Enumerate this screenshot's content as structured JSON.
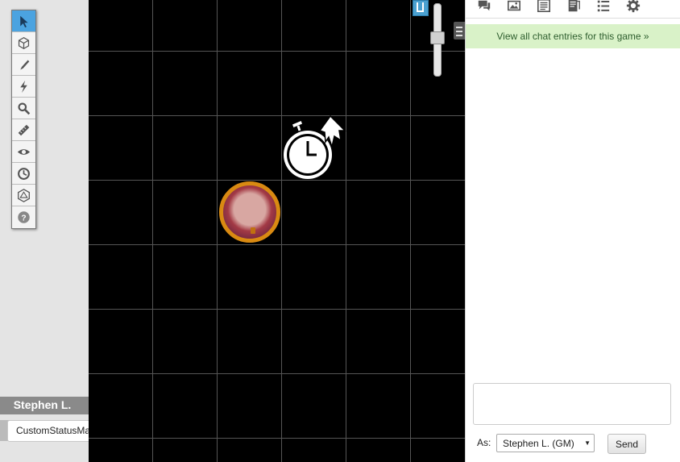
{
  "toolbar": {
    "tools": [
      {
        "name": "select-icon",
        "active": true
      },
      {
        "name": "layers-icon"
      },
      {
        "name": "draw-icon"
      },
      {
        "name": "fx-icon"
      },
      {
        "name": "zoom-icon"
      },
      {
        "name": "ruler-icon"
      },
      {
        "name": "fog-icon"
      },
      {
        "name": "turn-tracker-icon"
      },
      {
        "name": "dice-icon"
      },
      {
        "name": "help-icon"
      }
    ]
  },
  "player": {
    "name": "Stephen L.",
    "color": "#1ef0f0"
  },
  "tooltip": {
    "text": "CustomStatusMarkersMenu"
  },
  "map": {
    "background": "#000000",
    "grid_color": "#555555"
  },
  "right_panel": {
    "tabs": [
      "chat-icon",
      "art-library-icon",
      "journal-icon",
      "compendium-icon",
      "jukebox-list-icon",
      "settings-icon"
    ],
    "chat_link": "View all chat entries for this game »",
    "as_label": "As:",
    "as_value": "Stephen L. (GM)",
    "send_label": "Send"
  }
}
